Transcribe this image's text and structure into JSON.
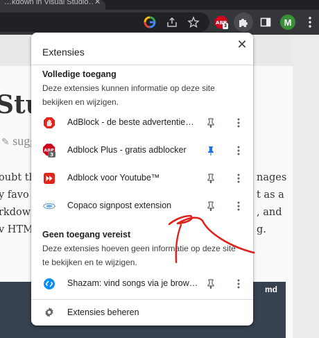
{
  "browser": {
    "tab_title": "…kdown in Visual Studio…",
    "tab_close": "✕",
    "profile_initial": "M",
    "abp_badge": "3"
  },
  "page_behind": {
    "heading": "Stud",
    "suggest": "sugg",
    "lines_left": [
      "oubt th",
      "y favo",
      "rkdow",
      "v HTM"
    ],
    "lines_right": [
      "nages",
      "t as a",
      ", and",
      "g."
    ],
    "code_lang": "md"
  },
  "popup": {
    "title": "Extensies",
    "close_glyph": "✕",
    "sections": [
      {
        "title": "Volledige toegang",
        "description": "Deze extensies kunnen informatie op deze site bekijken en wijzigen.",
        "items": [
          {
            "name": "AdBlock - de beste advertentie…",
            "icon": "adblock-hand-icon",
            "pinned": false
          },
          {
            "name": "Adblock Plus - gratis adblocker",
            "icon": "abp-icon",
            "badge": "3",
            "pinned": true
          },
          {
            "name": "Adblock voor Youtube™",
            "icon": "youtube-adblock-icon",
            "pinned": false
          },
          {
            "name": "Copaco signpost extension",
            "icon": "copaco-icon",
            "pinned": false
          }
        ]
      },
      {
        "title": "Geen toegang vereist",
        "description": "Deze extensies hoeven geen informatie op deze site te bekijken en te wijzigen.",
        "items": [
          {
            "name": "Shazam: vind songs via je brow…",
            "icon": "shazam-icon",
            "pinned": false
          }
        ]
      }
    ],
    "manage_label": "Extensies beheren"
  },
  "colors": {
    "chrome_dark": "#35363a",
    "pin_active": "#1a73e8",
    "pin_inactive": "#5f6368",
    "annotation_red": "#e0201b"
  }
}
